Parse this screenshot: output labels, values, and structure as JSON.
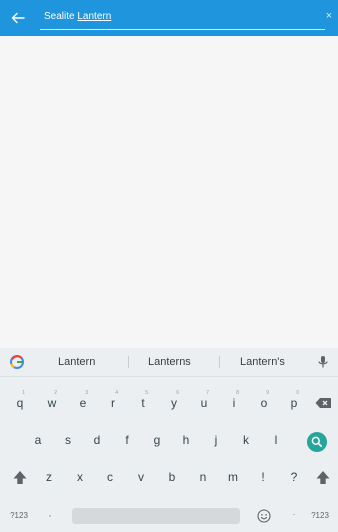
{
  "appbar": {
    "search_query_part1": "Sealite",
    "search_query_part2": "Lantern",
    "accent": "#1e95dc"
  },
  "keyboard": {
    "suggestions": [
      "Lantern",
      "Lanterns",
      "Lantern's"
    ],
    "row1": [
      {
        "k": "q",
        "h": "1"
      },
      {
        "k": "w",
        "h": "2"
      },
      {
        "k": "e",
        "h": "3"
      },
      {
        "k": "r",
        "h": "4"
      },
      {
        "k": "t",
        "h": "5"
      },
      {
        "k": "y",
        "h": "6"
      },
      {
        "k": "u",
        "h": "7"
      },
      {
        "k": "i",
        "h": "8"
      },
      {
        "k": "o",
        "h": "9"
      },
      {
        "k": "p",
        "h": "0"
      }
    ],
    "row2": [
      "a",
      "s",
      "d",
      "f",
      "g",
      "h",
      "j",
      "k",
      "l"
    ],
    "row3": [
      "z",
      "x",
      "c",
      "v",
      "b",
      "n",
      "m",
      "!",
      "?"
    ],
    "bottom_left": "?123",
    "comma": ",",
    "period": ".",
    "bottom_right": "?123"
  }
}
